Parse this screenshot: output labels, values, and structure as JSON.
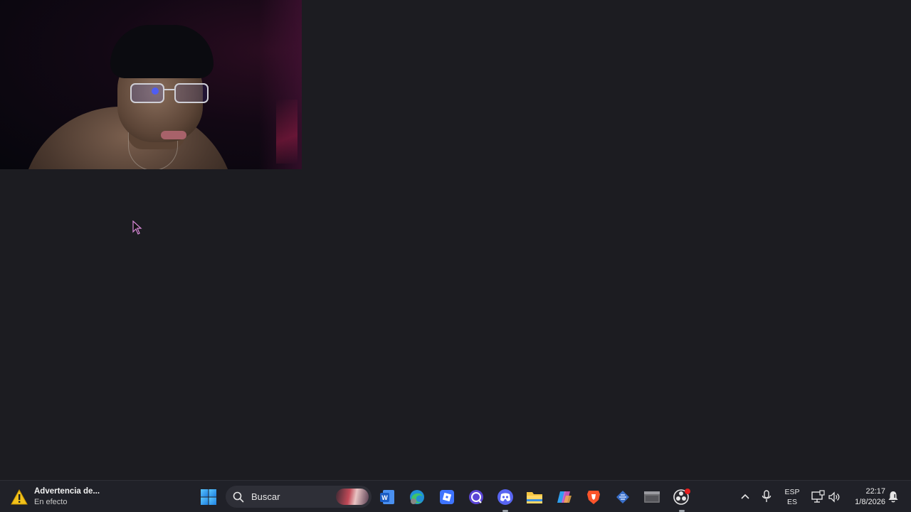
{
  "taskbar": {
    "weather": {
      "title": "Advertencia de...",
      "status": "En efecto",
      "icon": "warning-icon",
      "icon_color": "#f2c21b"
    },
    "search": {
      "placeholder": "Buscar",
      "icon": "search-icon"
    },
    "start_icon": "windows-start-icon",
    "apps": [
      {
        "name": "microsoft-word",
        "icon": "word-icon",
        "color": "#2b6fd6"
      },
      {
        "name": "microsoft-edge",
        "icon": "edge-icon",
        "color": "#2ba56c"
      },
      {
        "name": "roblox",
        "icon": "roblox-icon",
        "color": "#3e74ff"
      },
      {
        "name": "chat-app",
        "icon": "chat-bubble-icon",
        "color": "#5b46d6"
      },
      {
        "name": "discord",
        "icon": "discord-icon",
        "color": "#5865f2"
      },
      {
        "name": "file-explorer",
        "icon": "folder-icon",
        "color": "#f4c542"
      },
      {
        "name": "microsoft-copilot",
        "icon": "copilot-icon",
        "color": "#c46bd6"
      },
      {
        "name": "brave-browser",
        "icon": "brave-icon",
        "color": "#fb542b"
      },
      {
        "name": "app-diamond",
        "icon": "diamond-icon",
        "color": "#4a7fd0"
      },
      {
        "name": "app-window",
        "icon": "window-icon",
        "color": "#8a8a8a"
      },
      {
        "name": "obs-studio",
        "icon": "obs-icon",
        "color": "#e8e8e8"
      }
    ],
    "tray": {
      "chevron_icon": "chevron-up-icon",
      "mic_icon": "microphone-icon",
      "lang_top": "ESP",
      "lang_bottom": "ES",
      "network_icon": "network-icon",
      "volume_icon": "volume-icon",
      "time": "22:17",
      "date": "1/8/2026",
      "notification_icon": "notification-bell-icon"
    }
  },
  "desktop": {
    "webcam_icon": "webcam-feed",
    "cursor_icon": "mouse-cursor-icon"
  }
}
